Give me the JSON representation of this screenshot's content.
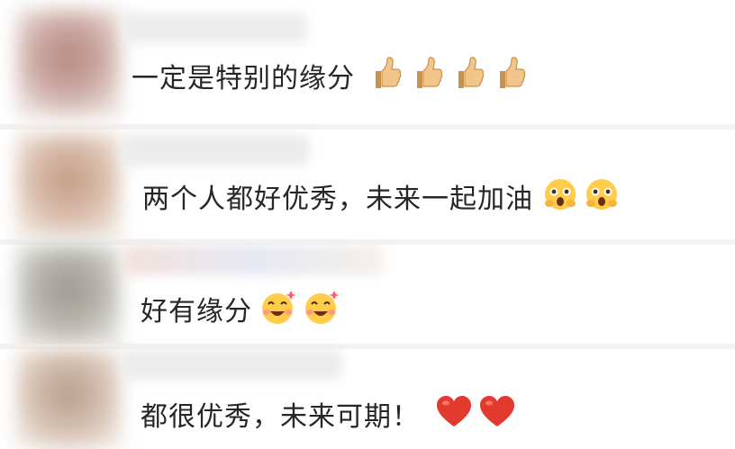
{
  "comments": [
    {
      "text": "一定是特别的缘分",
      "emoji_icon": "thumbs-up-icon",
      "emoji_count": 4
    },
    {
      "text": "两个人都好优秀，未来一起加油",
      "emoji_icon": "blushing-smile-emoji-icon",
      "emoji_count": 2
    },
    {
      "text": "好有缘分",
      "emoji_icon": "happy-sparkle-emoji-icon",
      "emoji_count": 2
    },
    {
      "text": "都很优秀，未来可期！",
      "emoji_icon": "red-heart-icon",
      "emoji_count": 2
    }
  ],
  "colors": {
    "text": "#262626",
    "heart": "#e23a2e",
    "emoji_yellow": "#ffcd4a"
  }
}
